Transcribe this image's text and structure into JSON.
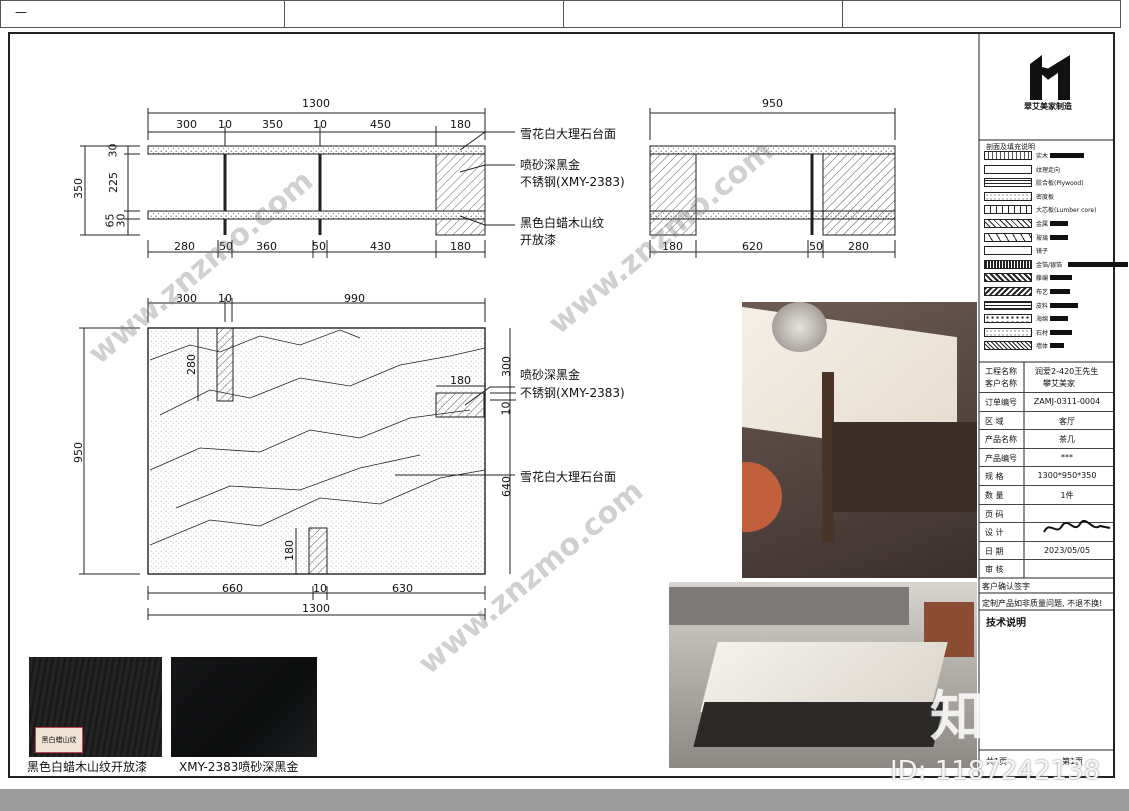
{
  "top": {
    "dash": "—"
  },
  "dims": {
    "front_total_top": "1300",
    "front_seg_top": [
      "300",
      "10",
      "350",
      "10",
      "450",
      "180"
    ],
    "front_height_total": "350",
    "front_height_segs": [
      "30",
      "225",
      "65",
      "30"
    ],
    "front_seg_bottom": [
      "280",
      "50",
      "360",
      "50",
      "430",
      "180"
    ],
    "side_total_top": "950",
    "side_seg_bottom": [
      "180",
      "620",
      "50",
      "280"
    ],
    "plan_top_segs": [
      "300",
      "10",
      "990"
    ],
    "plan_left": "950",
    "plan_leg_h_top": "280",
    "plan_leg_h_bottom": "180",
    "plan_insert_w": "180",
    "plan_right_segs": [
      "300",
      "10",
      "640"
    ],
    "plan_bottom_segs": [
      "660",
      "10",
      "630"
    ],
    "plan_total_bottom": "1300"
  },
  "notes": {
    "marble_top": "雪花白大理石台面",
    "steel_l1": "喷砂深黑金",
    "steel_l2": "不锈钢(XMY-2383)",
    "wood_l1": "黑色白蜡木山纹",
    "wood_l2": "开放漆",
    "plan_steel_l1": "喷砂深黑金",
    "plan_steel_l2": "不锈钢(XMY-2383)",
    "plan_marble": "雪花白大理石台面"
  },
  "samples": [
    {
      "caption": "黑色白蜡木山纹开放漆"
    },
    {
      "caption": "XMY-2383喷砂深黑金"
    }
  ],
  "sample_tag": "黑白蜡山纹",
  "title_block": {
    "brand": "翠艾美家制造",
    "legend_title": "剖面及填充说明",
    "legend": [
      {
        "label": "实木"
      },
      {
        "label": "纹理走向"
      },
      {
        "label": "胶合板(Plywood)"
      },
      {
        "label": "密度板"
      },
      {
        "label": "大芯板(Lumber core)"
      },
      {
        "label": "金属"
      },
      {
        "label": "玻璃"
      },
      {
        "label": "镜子"
      },
      {
        "label": "金箔/银箔"
      },
      {
        "label": "藤编"
      },
      {
        "label": "布艺"
      },
      {
        "label": "皮料"
      },
      {
        "label": "海绵"
      },
      {
        "label": "石材"
      },
      {
        "label": "墙体"
      }
    ],
    "project_label": "工程名称",
    "client_label": "客户名称",
    "project_value": "润爱2-420王先生",
    "client_value": "攀艾美家",
    "rows": [
      {
        "k": "订单编号",
        "v": "ZAMJ-0311-0004"
      },
      {
        "k": "区 域",
        "v": "客厅"
      },
      {
        "k": "产品名称",
        "v": "茶几"
      },
      {
        "k": "产品编号",
        "v": "***"
      },
      {
        "k": "规 格",
        "v": "1300*950*350"
      },
      {
        "k": "数 量",
        "v": "1件"
      },
      {
        "k": "页 码",
        "v": ""
      },
      {
        "k": "设 计",
        "v": ""
      },
      {
        "k": "日 期",
        "v": "2023/05/05"
      },
      {
        "k": "审 核",
        "v": ""
      }
    ],
    "client_confirm": "客户确认签字",
    "custom_note": "定制产品如非质量问题, 不退不换!",
    "tech_note": "技术说明",
    "bottom_label": "共1页",
    "bottom_value": "第1页"
  },
  "watermarks": {
    "site": "www.znzmo.com",
    "brand_big": "知末",
    "id_text": "ID: 1187242138"
  }
}
